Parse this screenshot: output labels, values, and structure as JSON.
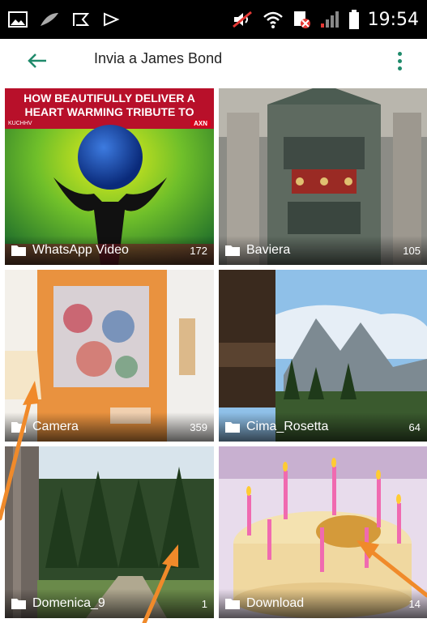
{
  "status_bar": {
    "time": "19:54"
  },
  "app_bar": {
    "title": "Invia a  James Bond"
  },
  "albums": [
    {
      "name": "WhatsApp Video",
      "count": "172"
    },
    {
      "name": "Baviera",
      "count": "105"
    },
    {
      "name": "Camera",
      "count": "359"
    },
    {
      "name": "Cima_Rosetta",
      "count": "64"
    },
    {
      "name": "Domenica_9",
      "count": "1"
    },
    {
      "name": "Download",
      "count": "14"
    }
  ],
  "whatsapp_thumb": {
    "headline": "HOW BEAUTIFULLY DELIVER A HEART WARMING TRIBUTE TO",
    "channel_left": "KUCHHV",
    "channel_right": "AXN"
  },
  "colors": {
    "accent": "#1f8a6b",
    "annotation_arrow": "#f08a2a"
  }
}
